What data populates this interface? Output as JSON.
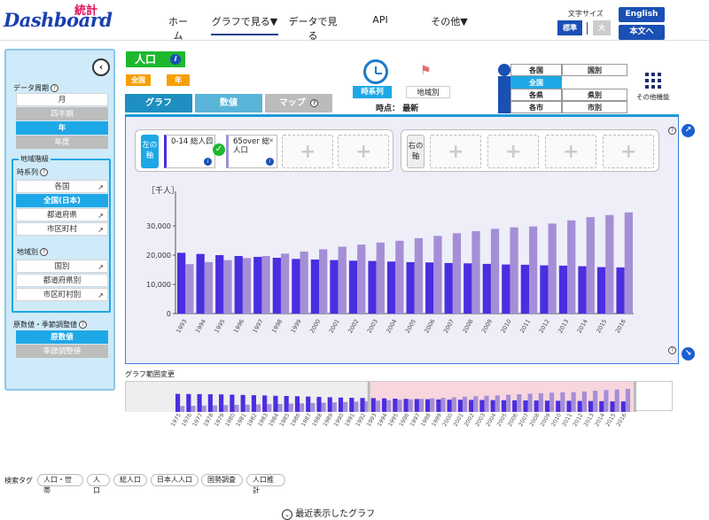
{
  "header": {
    "logo_main": "Dashboard",
    "logo_sub": "統計",
    "nav": [
      "ホーム",
      "グラフで見る▼",
      "データで見る",
      "API",
      "その他▼"
    ],
    "font_size_label": "文字サイズ",
    "font_standard": "標準",
    "font_large": "大",
    "lang_english": "English",
    "lang_plain": "本文へ"
  },
  "sidebar": {
    "period_heading": "データ周期",
    "periods": [
      "月",
      "四半期",
      "年",
      "年度"
    ],
    "region_level_heading": "地域階級",
    "timeseries_heading": "時系列",
    "timeseries_items": [
      "各国",
      "全国(日本)",
      "都道府県",
      "市区町村"
    ],
    "regional_heading": "地域別",
    "regional_items": [
      "国別",
      "都道府県別",
      "市区町村別"
    ],
    "adjust_heading": "原数値・季節調整値",
    "adjust_items": [
      "原数値",
      "季節調整値"
    ]
  },
  "main": {
    "category_title": "人口",
    "tag_nationwide": "全国",
    "tag_year": "年",
    "tabs": [
      "グラフ",
      "数値",
      "マップ"
    ],
    "view_timeseries": "時系列",
    "view_regional": "地域別",
    "time_point_label": "時点：",
    "time_point_value": "最新",
    "region_table": [
      [
        "各国",
        "国別"
      ],
      [
        "全国",
        ""
      ],
      [
        "各県",
        "県別"
      ],
      [
        "各市",
        "市別"
      ]
    ],
    "other_functions": "その他機能"
  },
  "axes": {
    "left_label": "左の軸",
    "right_label": "右の軸",
    "series": [
      {
        "label": "0-14 総人口",
        "color": "#4a2ee0"
      },
      {
        "label": "65over 総人口",
        "color": "#a48fd6"
      }
    ]
  },
  "chart_data": {
    "type": "bar",
    "ylabel": "［千人］",
    "ylim": [
      0,
      40000
    ],
    "yticks": [
      "0",
      "10,000",
      "20,000",
      "30,000"
    ],
    "categories": [
      "1993",
      "1994",
      "1995",
      "1996",
      "1997",
      "1998",
      "1999",
      "2000",
      "2001",
      "2002",
      "2003",
      "2004",
      "2005",
      "2006",
      "2007",
      "2008",
      "2009",
      "2010",
      "2011",
      "2012",
      "2013",
      "2014",
      "2015",
      "2016"
    ],
    "series": [
      {
        "name": "0-14 総人口",
        "color": "#4a2ee0",
        "values": [
          20800,
          20400,
          20000,
          19700,
          19400,
          19100,
          18700,
          18500,
          18300,
          18100,
          18000,
          17800,
          17600,
          17500,
          17300,
          17200,
          17000,
          16800,
          16700,
          16500,
          16400,
          16200,
          15900,
          15800
        ]
      },
      {
        "name": "65over 総人口",
        "color": "#a48fd6",
        "values": [
          16900,
          17600,
          18300,
          19000,
          19700,
          20500,
          21200,
          22000,
          22900,
          23600,
          24300,
          24900,
          25800,
          26600,
          27500,
          28200,
          29000,
          29500,
          29800,
          30800,
          31900,
          33000,
          33700,
          34600
        ]
      }
    ]
  },
  "range": {
    "label": "グラフ範囲変更",
    "years": [
      "1975",
      "1976",
      "1977",
      "1978",
      "1979",
      "1980",
      "1981",
      "1982",
      "1983",
      "1984",
      "1985",
      "1986",
      "1987",
      "1988",
      "1989",
      "1990",
      "1991",
      "1992",
      "1993",
      "1994",
      "1995",
      "1996",
      "1997",
      "1998",
      "1999",
      "2000",
      "2001",
      "2002",
      "2003",
      "2004",
      "2005",
      "2006",
      "2007",
      "2008",
      "2009",
      "2010",
      "2011",
      "2012",
      "2013",
      "2014",
      "2015",
      "2016"
    ],
    "series_a": [
      27200,
      27000,
      26800,
      26600,
      26400,
      26000,
      25600,
      25200,
      24800,
      24300,
      24000,
      23600,
      23100,
      22600,
      22100,
      21600,
      21300,
      21000,
      20800,
      20400,
      20000,
      19700,
      19400,
      19100,
      18700,
      18500,
      18300,
      18100,
      18000,
      17800,
      17600,
      17500,
      17300,
      17200,
      17000,
      16800,
      16700,
      16500,
      16400,
      16200,
      15900,
      15800
    ],
    "series_b": [
      8900,
      9200,
      9500,
      9900,
      10300,
      10600,
      11000,
      11400,
      11700,
      12000,
      12500,
      12900,
      13400,
      13900,
      14300,
      14900,
      15500,
      16200,
      16900,
      17600,
      18300,
      19000,
      19700,
      20500,
      21200,
      22000,
      22900,
      23600,
      24300,
      24900,
      25800,
      26600,
      27500,
      28200,
      29000,
      29500,
      29800,
      30800,
      31900,
      33000,
      33700,
      34600
    ],
    "selected_start": "1993",
    "selected_end": "2016"
  },
  "footer": {
    "tag_label": "検索タグ",
    "tags": [
      "人口・世帯",
      "人口",
      "総人口",
      "日本人人口",
      "国勢調査",
      "人口推計"
    ],
    "recent": "最近表示したグラフ"
  }
}
